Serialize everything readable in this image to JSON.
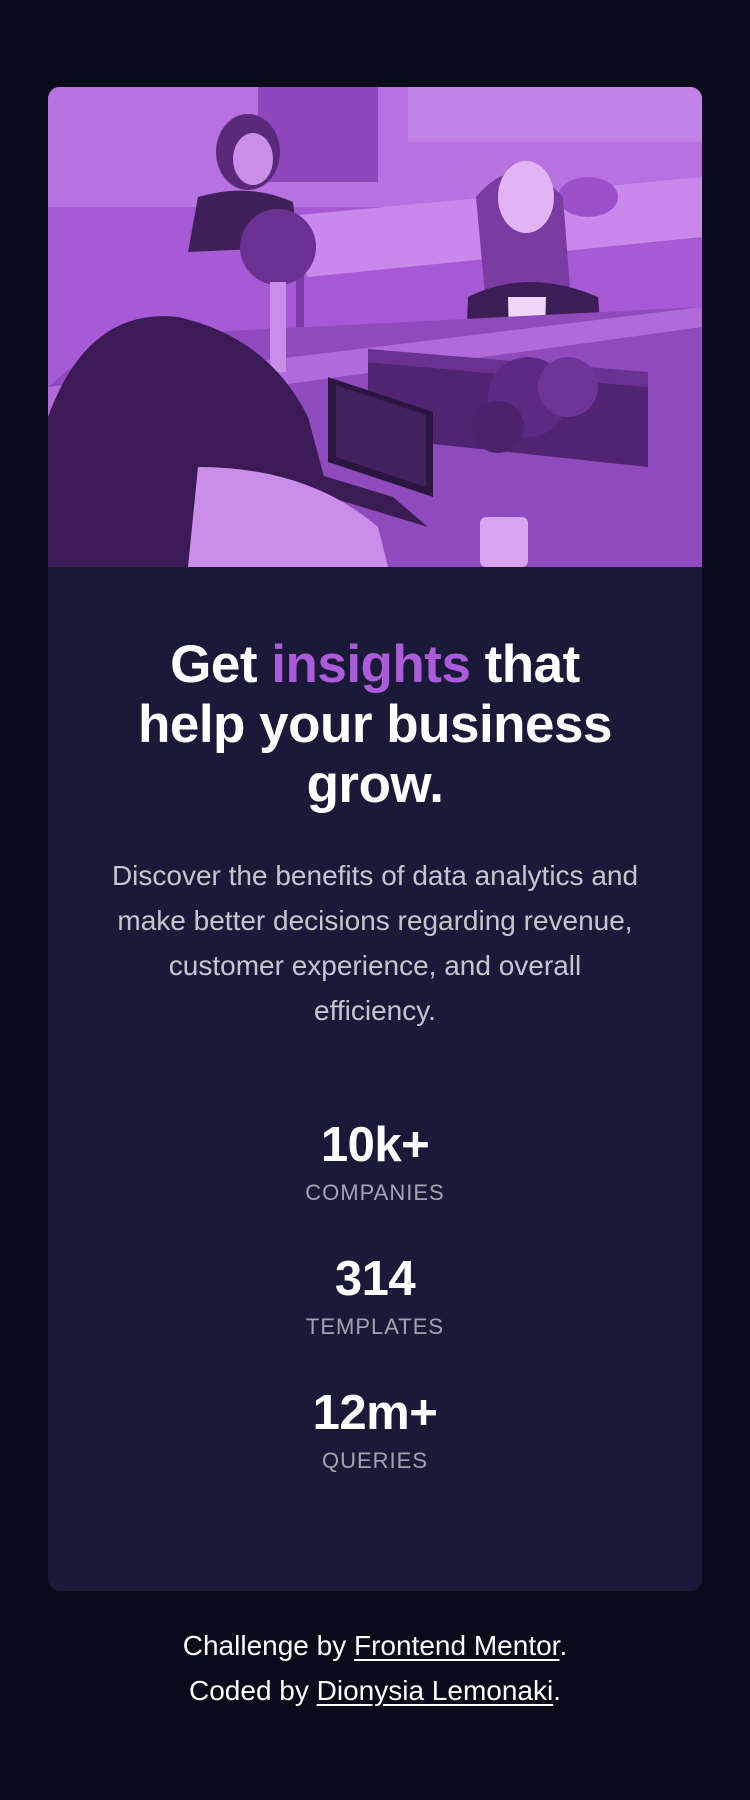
{
  "hero": {
    "image_alt": "Three women working at a desk with laptops in an office, tinted purple"
  },
  "headline": {
    "before": "Get ",
    "accent": "insights",
    "after": " that help your business grow."
  },
  "lead": "Discover the benefits of data analytics and make better decisions regarding revenue, customer experience, and overall efficiency.",
  "stats": [
    {
      "value": "10k+",
      "label": "Companies"
    },
    {
      "value": "314",
      "label": "Templates"
    },
    {
      "value": "12m+",
      "label": "Queries"
    }
  ],
  "attribution": {
    "line1_prefix": "Challenge by ",
    "line1_link": "Frontend Mentor",
    "line1_suffix": ".",
    "line2_prefix": "Coded by ",
    "line2_link": "Dionysia Lemonaki",
    "line2_suffix": "."
  },
  "colors": {
    "page_background": "#090b1a",
    "card_background": "#1b1938",
    "accent": "#ab5cdb",
    "image_tint": "#aa5cdb"
  }
}
